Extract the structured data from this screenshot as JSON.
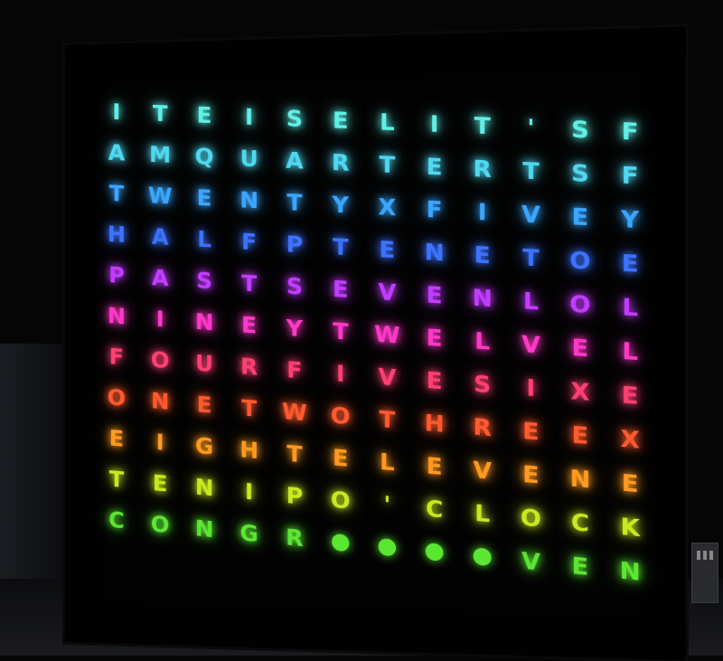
{
  "clock_face": {
    "rows": [
      {
        "letters": [
          "I",
          "T",
          "E",
          "I",
          "S",
          "E",
          "L",
          "I",
          "T",
          "'",
          "S",
          "F"
        ],
        "color": "#5ff0e6"
      },
      {
        "letters": [
          "A",
          "M",
          "Q",
          "U",
          "A",
          "R",
          "T",
          "E",
          "R",
          "T",
          "S",
          "F"
        ],
        "color": "#4fd8f0"
      },
      {
        "letters": [
          "T",
          "W",
          "E",
          "N",
          "T",
          "Y",
          "X",
          "F",
          "I",
          "V",
          "E",
          "Y"
        ],
        "color": "#3aa6ff"
      },
      {
        "letters": [
          "H",
          "A",
          "L",
          "F",
          "P",
          "T",
          "E",
          "N",
          "E",
          "T",
          "O",
          "E"
        ],
        "color": "#3d72ff"
      },
      {
        "letters": [
          "P",
          "A",
          "S",
          "T",
          "S",
          "E",
          "V",
          "E",
          "N",
          "L",
          "O",
          "L"
        ],
        "color": "#c23cff"
      },
      {
        "letters": [
          "N",
          "I",
          "N",
          "E",
          "Y",
          "T",
          "W",
          "E",
          "L",
          "V",
          "E",
          "L"
        ],
        "color": "#ff38c8"
      },
      {
        "letters": [
          "F",
          "O",
          "U",
          "R",
          "F",
          "I",
          "V",
          "E",
          "S",
          "I",
          "X",
          "E"
        ],
        "color": "#ff3f74"
      },
      {
        "letters": [
          "O",
          "N",
          "E",
          "T",
          "W",
          "O",
          "T",
          "H",
          "R",
          "E",
          "E",
          "X"
        ],
        "color": "#ff5a2e"
      },
      {
        "letters": [
          "E",
          "I",
          "G",
          "H",
          "T",
          "E",
          "L",
          "E",
          "V",
          "E",
          "N",
          "E"
        ],
        "color": "#ff9a1f"
      },
      {
        "letters": [
          "T",
          "E",
          "N",
          "I",
          "P",
          "O",
          "'",
          "C",
          "L",
          "O",
          "C",
          "K"
        ],
        "color": "#c9e81f"
      },
      {
        "letters": [
          "C",
          "O",
          "N",
          "G",
          "R",
          "●",
          "●",
          "●",
          "●",
          "V",
          "E",
          "N"
        ],
        "color": "#5be632"
      },
      {
        "letters": [
          "",
          "",
          "",
          "",
          "",
          "",
          "",
          "",
          "",
          "",
          "",
          ""
        ],
        "color": "#2fe06a"
      }
    ]
  }
}
